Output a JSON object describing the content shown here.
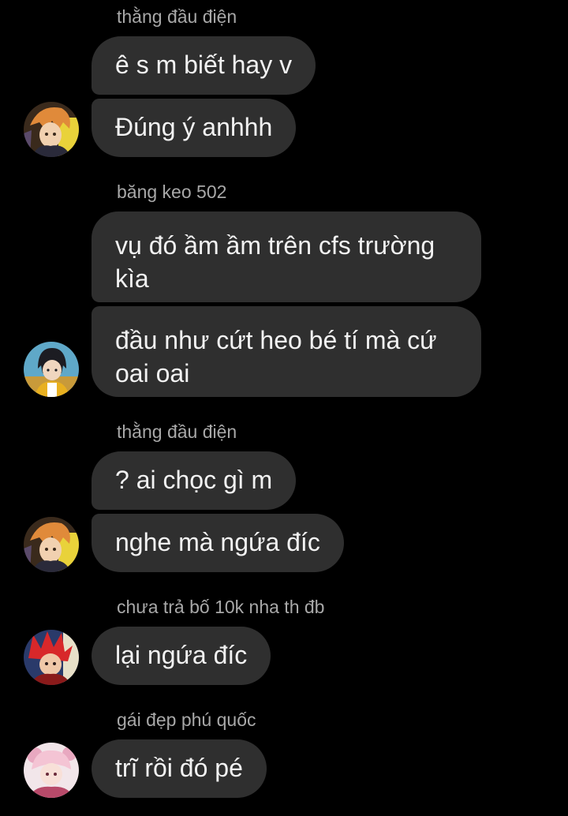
{
  "messages": [
    {
      "sender": "thằng đầu điện",
      "bubbles": [
        "ê s m biết hay v",
        "Đúng ý anhhh"
      ],
      "avatar": "avatar-icon-orange-hair-anime"
    },
    {
      "sender": "băng keo 502",
      "bubbles": [
        "vụ đó ầm ầm trên cfs trường kìa",
        "đầu như cứt heo bé tí mà cứ oai oai"
      ],
      "avatar": "avatar-icon-dark-hair-anime"
    },
    {
      "sender": "thằng đầu điện",
      "bubbles": [
        "? ai chọc gì m",
        "nghe mà ngứa đíc"
      ],
      "avatar": "avatar-icon-orange-hair-anime"
    },
    {
      "sender": "chưa trả bố 10k nha th đb",
      "bubbles": [
        "lại ngứa đíc"
      ],
      "avatar": "avatar-icon-red-hair-anime"
    },
    {
      "sender": "gái đẹp phú quốc",
      "bubbles": [
        "trĩ rồi đó pé"
      ],
      "avatar": "avatar-icon-pink-anime"
    }
  ],
  "colors": {
    "background": "#000000",
    "bubble": "#2f2f2f",
    "bubble_text": "#f2f2f2",
    "sender_text": "#a8a8a8"
  }
}
